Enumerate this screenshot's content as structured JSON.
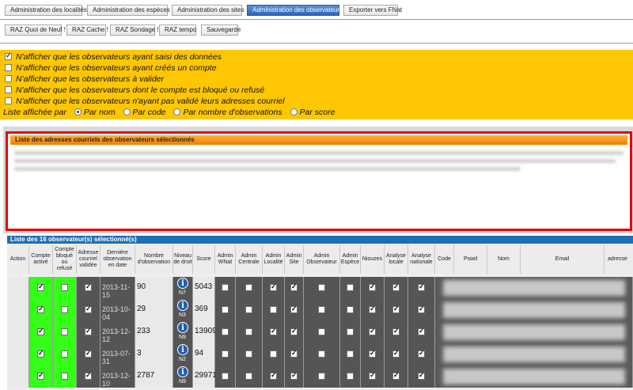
{
  "nav_buttons": [
    "Administration des localités",
    "Administration des espèces",
    "Administration des sites",
    "Administration des observateurs",
    "Exporter vers FNat"
  ],
  "reset_buttons": [
    "RAZ Quoi de Neuf !",
    "RAZ Cache !",
    "RAZ Sondage !",
    "RAZ tempo",
    "Sauvegarde"
  ],
  "filters": [
    {
      "label": "N'afficher que les observateurs ayant saisi des données",
      "checked": true
    },
    {
      "label": "N'afficher que les observateurs ayant créés un compte",
      "checked": false
    },
    {
      "label": "N'afficher que les observateurs à valider",
      "checked": false
    },
    {
      "label": "N'afficher que les observateurs dont le compte est bloqué ou refusé",
      "checked": false
    },
    {
      "label": "N'afficher que les observateurs n'ayant pas validé leurs adresses courriel",
      "checked": false
    }
  ],
  "sort": {
    "label": "Liste affichée par",
    "options": [
      "Par nom",
      "Par code",
      "Par nombre d'observations",
      "Par score"
    ],
    "selected": 0
  },
  "email_panel": {
    "title": "Liste des adresses courriels des observateurs sélectionnés"
  },
  "table": {
    "title": "Liste des 16 observateur(s) sélectionné(s)",
    "headers": [
      "Action",
      "Compte activé",
      "Compte bloqué ou refusé",
      "Adresse courriel validée",
      "Dernière observation en date",
      "Nombre d'observation",
      "Niveau de droit",
      "Score",
      "Admin WNat",
      "Admin Centrale",
      "Admin Localité",
      "Admin Site",
      "Admin Observateur",
      "Admin Espèce",
      "Niouzes",
      "Analyse locale",
      "Analyse nationale",
      "Code",
      "Pswd",
      "Nom",
      "Email",
      "adresse"
    ],
    "rows": [
      {
        "date": "2013-11-15",
        "count": "90",
        "level": "N7",
        "score": "5043",
        "flags": [
          1,
          0,
          1,
          0,
          0,
          1,
          1,
          0,
          0,
          1,
          1,
          1
        ]
      },
      {
        "date": "2013-10-04",
        "count": "29",
        "level": "N3",
        "score": "369",
        "flags": [
          1,
          0,
          1,
          0,
          0,
          0,
          1,
          0,
          0,
          1,
          1,
          1
        ]
      },
      {
        "date": "2013-12-12",
        "count": "233",
        "level": "N9",
        "score": "13909",
        "flags": [
          1,
          0,
          1,
          0,
          0,
          1,
          1,
          0,
          0,
          1,
          1,
          1
        ]
      },
      {
        "date": "2013-07-31",
        "count": "3",
        "level": "N2",
        "score": "94",
        "flags": [
          1,
          0,
          1,
          0,
          0,
          0,
          1,
          0,
          0,
          1,
          1,
          1
        ]
      },
      {
        "date": "2013-12-10",
        "count": "2787",
        "level": "N9",
        "score": "29971",
        "flags": [
          1,
          0,
          1,
          0,
          0,
          1,
          1,
          0,
          0,
          1,
          1,
          1
        ]
      }
    ]
  },
  "colors": {
    "filter_bg": "#ffc703",
    "active_btn": "#3a72c4",
    "table_title": "#1e6fb4",
    "row_bg": "#555555",
    "green": "#35ff18",
    "highlight": "#e60000"
  }
}
